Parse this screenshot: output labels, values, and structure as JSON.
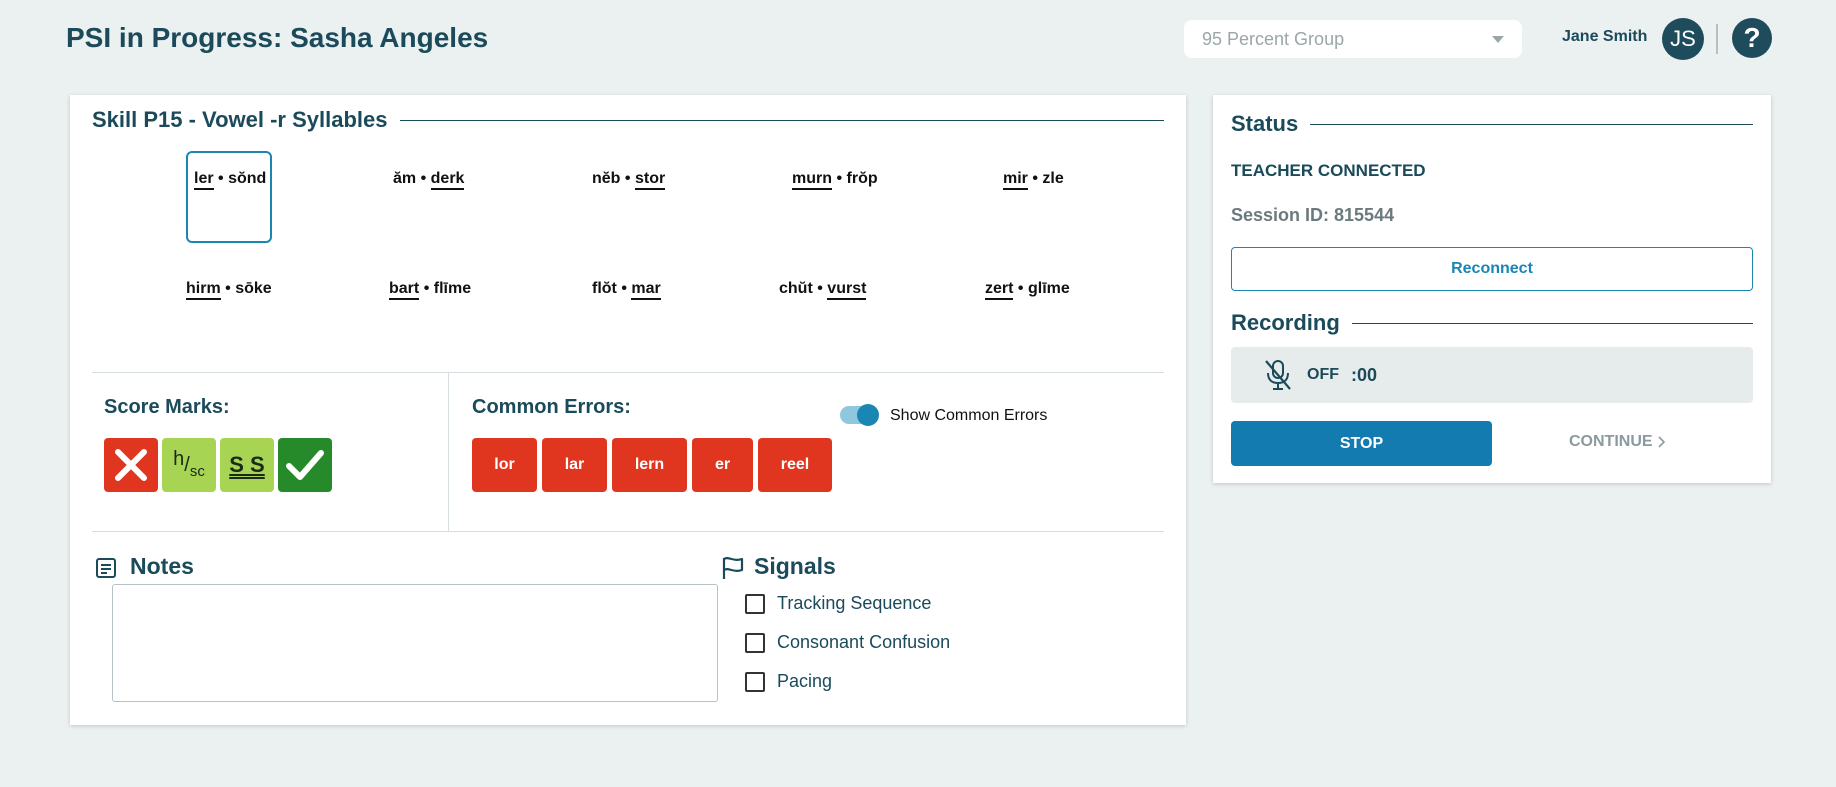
{
  "header": {
    "title": "PSI in Progress: Sasha Angeles",
    "group_select": {
      "value": "95 Percent Group"
    },
    "user_name": "Jane Smith",
    "avatar_initials": "JS",
    "help_symbol": "?"
  },
  "skill": {
    "title": "Skill P15 - Vowel -r Syllables",
    "words": [
      {
        "a": "ler",
        "b": "sŏnd",
        "underline": "a",
        "selected": true
      },
      {
        "a": "ăm",
        "b": "derk",
        "underline": "b",
        "selected": false
      },
      {
        "a": "nĕb",
        "b": "stor",
        "underline": "b",
        "selected": false
      },
      {
        "a": "murn",
        "b": "frŏp",
        "underline": "a",
        "selected": false
      },
      {
        "a": "mir",
        "b": "zle",
        "underline": "a",
        "selected": false
      },
      {
        "a": "hirm",
        "b": "sōke",
        "underline": "a",
        "selected": false
      },
      {
        "a": "bart",
        "b": "flīme",
        "underline": "a",
        "selected": false
      },
      {
        "a": "flŏt",
        "b": "mar",
        "underline": "b",
        "selected": false
      },
      {
        "a": "chŭt",
        "b": "vurst",
        "underline": "b",
        "selected": false
      },
      {
        "a": "zert",
        "b": "glīme",
        "underline": "a",
        "selected": false
      }
    ],
    "separator": "•"
  },
  "score_marks": {
    "label": "Score Marks:",
    "hsc": {
      "h": "h",
      "sc": "sc"
    },
    "ss": "S S"
  },
  "common_errors": {
    "label": "Common Errors:",
    "buttons": [
      "lor",
      "lar",
      "lern",
      "er",
      "reel"
    ],
    "toggle_label": "Show Common Errors",
    "toggle_on": true
  },
  "notes": {
    "label": "Notes",
    "value": ""
  },
  "signals": {
    "label": "Signals",
    "items": [
      "Tracking Sequence",
      "Consonant Confusion",
      "Pacing"
    ]
  },
  "status": {
    "title": "Status",
    "connection": "TEACHER CONNECTED",
    "session_id": "Session ID: 815544",
    "reconnect_label": "Reconnect"
  },
  "recording": {
    "title": "Recording",
    "state": "OFF",
    "time": ":00",
    "stop_label": "STOP",
    "continue_label": "CONTINUE"
  },
  "colors": {
    "primary": "#137bb0",
    "error_red": "#e0351f",
    "mark_green_light": "#a8d454",
    "mark_green_dark": "#278a2a",
    "text_dark": "#1b4a5a"
  }
}
